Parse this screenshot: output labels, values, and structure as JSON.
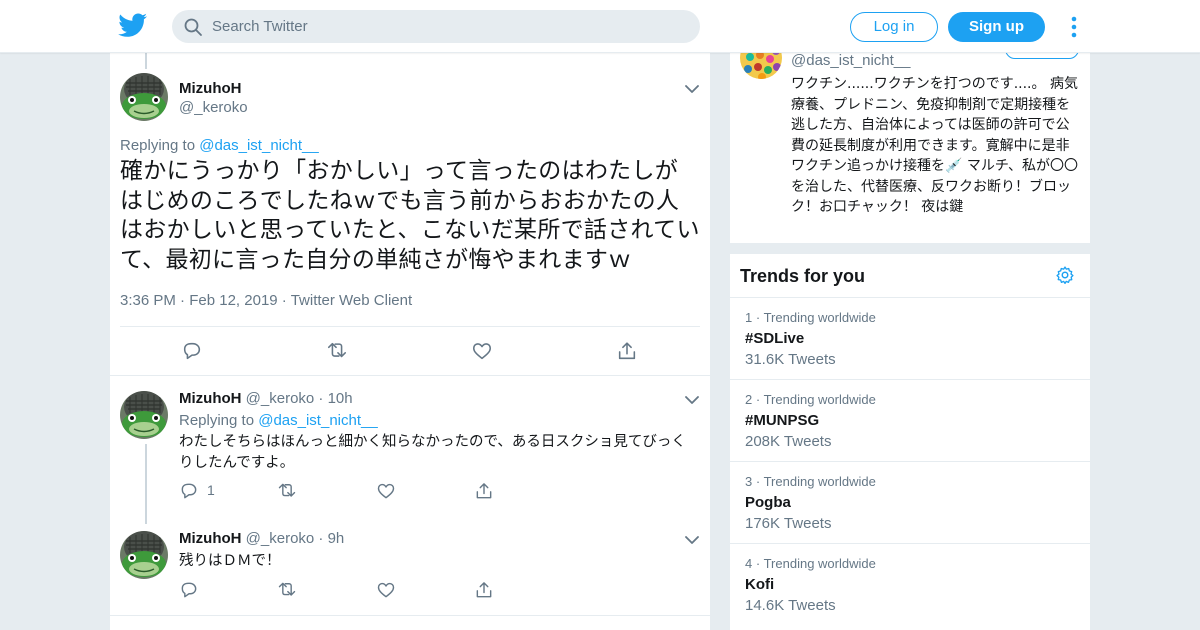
{
  "header": {
    "logo_icon": "twitter-bird-icon",
    "search_placeholder": "Search Twitter",
    "login_label": "Log in",
    "signup_label": "Sign up",
    "accent": "#1da1f2"
  },
  "focus_tweet": {
    "name": "MizuhoH",
    "handle": "@_keroko",
    "replying_prefix": "Replying to",
    "replying_to": "@das_ist_nicht__",
    "text": "確かにうっかり「おかしい」って言ったのはわたしがはじめのころでしたねｗでも言う前からおおかたの人はおかしいと思っていたと、こないだ某所で話されていて、最初に言った自分の単純さが悔やまれますｗ",
    "time": "3:36 PM",
    "date": "Feb 12, 2019",
    "source": "Twitter Web Client",
    "dot": "·"
  },
  "replies": [
    {
      "name": "MizuhoH",
      "handle": "@_keroko",
      "dot": "·",
      "age": "10h",
      "replying_prefix": "Replying to",
      "replying_to": "@das_ist_nicht__",
      "text": "わたしそちらはほんっと細かく知らなかったので、ある日スクショ見てびっくりしたんですよ。",
      "reply_count": "1"
    },
    {
      "name": "MizuhoH",
      "handle": "@_keroko",
      "dot": "·",
      "age": "9h",
      "text": "残りはＤＭで！"
    }
  ],
  "profile_card": {
    "handle": "@das_ist_nicht__",
    "bio": "ワクチン......ワクチンを打つのです....。 病気療養、プレドニン、免疫抑制剤で定期接種を逃した方、自治体によっては医師の許可で公費の延長制度が利用できます。寛解中に是非ワクチン追っかけ接種を💉 マルチ、私が〇〇を治した、代替医療、反ワクお断り！ブロック！お口チャック！ 夜は鍵"
  },
  "trends": {
    "title": "Trends for you",
    "items": [
      {
        "rank": "1",
        "dot": "·",
        "context": "Trending worldwide",
        "name": "#SDLive",
        "count": "31.6K Tweets"
      },
      {
        "rank": "2",
        "dot": "·",
        "context": "Trending worldwide",
        "name": "#MUNPSG",
        "count": "208K Tweets"
      },
      {
        "rank": "3",
        "dot": "·",
        "context": "Trending worldwide",
        "name": "Pogba",
        "count": "176K Tweets"
      },
      {
        "rank": "4",
        "dot": "·",
        "context": "Trending worldwide",
        "name": "Kofi",
        "count": "14.6K Tweets"
      }
    ]
  }
}
